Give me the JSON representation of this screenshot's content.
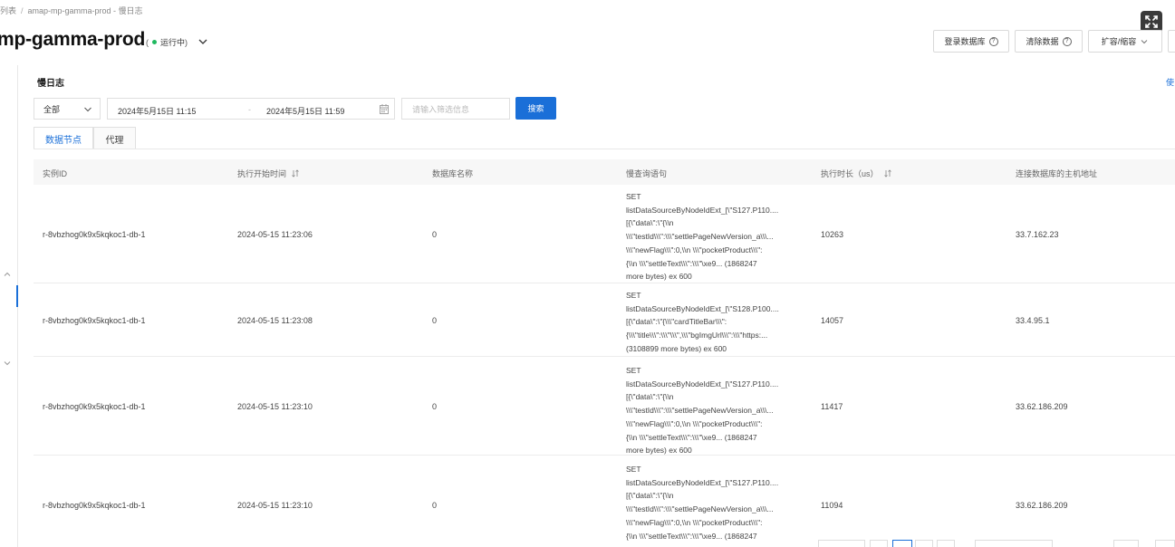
{
  "breadcrumb": {
    "parent": "列表",
    "separator": "/",
    "current": "amap-mp-gamma-prod - 慢日志"
  },
  "header": {
    "title": "mp-gamma-prod",
    "status_open": "(",
    "status": "运行中",
    "status_close": ")",
    "buttons": {
      "login_db": "登录数据库",
      "clear_data": "清除数据",
      "scale": "扩容/缩容"
    }
  },
  "section": {
    "title": "慢日志",
    "right_link": "使"
  },
  "filters": {
    "select_value": "全部",
    "date_start": "2024年5月15日 11:15",
    "date_separator": "-",
    "date_end": "2024年5月15日 11:59",
    "keyword_placeholder": "请输入筛选信息",
    "search_label": "搜索"
  },
  "tabs": [
    {
      "label": "数据节点",
      "active": true
    },
    {
      "label": "代理",
      "active": false
    }
  ],
  "table": {
    "columns": [
      "实例ID",
      "执行开始时间",
      "数据库名称",
      "慢查询语句",
      "执行时长（us）",
      "连接数据库的主机地址"
    ],
    "rows": [
      {
        "instance_id": "r-8vbzhog0k9x5kqkoc1-db-1",
        "start_time": "2024-05-15 11:23:06",
        "db_name": "0",
        "sql": "SET\nlistDataSourceByNodeIdExt_[\\\"S127.P110....\n[{\\\"data\\\":\\\"{\\\\n\n\\\\\\\"testId\\\\\\\":\\\\\\\"settlePageNewVersion_a\\\\\\...\n\\\\\\\"newFlag\\\\\\\":0,\\\\n \\\\\\\"pocketProduct\\\\\\\":\n{\\\\n \\\\\\\"settleText\\\\\\\":\\\\\\\"\\xe9... (1868247\nmore bytes) ex 600",
        "duration": "10263",
        "host": "33.7.162.23"
      },
      {
        "instance_id": "r-8vbzhog0k9x5kqkoc1-db-1",
        "start_time": "2024-05-15 11:23:08",
        "db_name": "0",
        "sql": "SET\nlistDataSourceByNodeIdExt_[\\\"S128.P100....\n[{\\\"data\\\":\\\"{\\\\\\\"cardTitleBar\\\\\\\":\n{\\\\\\\"title\\\\\\\":\\\\\\\"\\\\\\\",\\\\\\\"bgImgUrl\\\\\\\":\\\\\\\"https:...\n(3108899 more bytes) ex 600",
        "duration": "14057",
        "host": "33.4.95.1"
      },
      {
        "instance_id": "r-8vbzhog0k9x5kqkoc1-db-1",
        "start_time": "2024-05-15 11:23:10",
        "db_name": "0",
        "sql": "SET\nlistDataSourceByNodeIdExt_[\\\"S127.P110....\n[{\\\"data\\\":\\\"{\\\\n\n\\\\\\\"testId\\\\\\\":\\\\\\\"settlePageNewVersion_a\\\\\\...\n\\\\\\\"newFlag\\\\\\\":0,\\\\n \\\\\\\"pocketProduct\\\\\\\":\n{\\\\n \\\\\\\"settleText\\\\\\\":\\\\\\\"\\xe9... (1868247\nmore bytes) ex 600",
        "duration": "11417",
        "host": "33.62.186.209"
      },
      {
        "instance_id": "r-8vbzhog0k9x5kqkoc1-db-1",
        "start_time": "2024-05-15 11:23:10",
        "db_name": "0",
        "sql": "SET\nlistDataSourceByNodeIdExt_[\\\"S127.P110....\n[{\\\"data\\\":\\\"{\\\\n\n\\\\\\\"testId\\\\\\\":\\\\\\\"settlePageNewVersion_a\\\\\\...\n\\\\\\\"newFlag\\\\\\\":0,\\\\n \\\\\\\"pocketProduct\\\\\\\":\n{\\\\n \\\\\\\"settleText\\\\\\\":\\\\\\\"\\xe9... (1868247",
        "duration": "11094",
        "host": "33.62.186.209"
      }
    ]
  },
  "icons": {
    "status": "status-dot-icon",
    "help": "help-circle-icon",
    "calendar": "calendar-icon",
    "sort": "sort-icon",
    "expand": "fullscreen-icon"
  },
  "colors": {
    "accent": "#1a6fd8",
    "status_running": "#1fb85f"
  }
}
